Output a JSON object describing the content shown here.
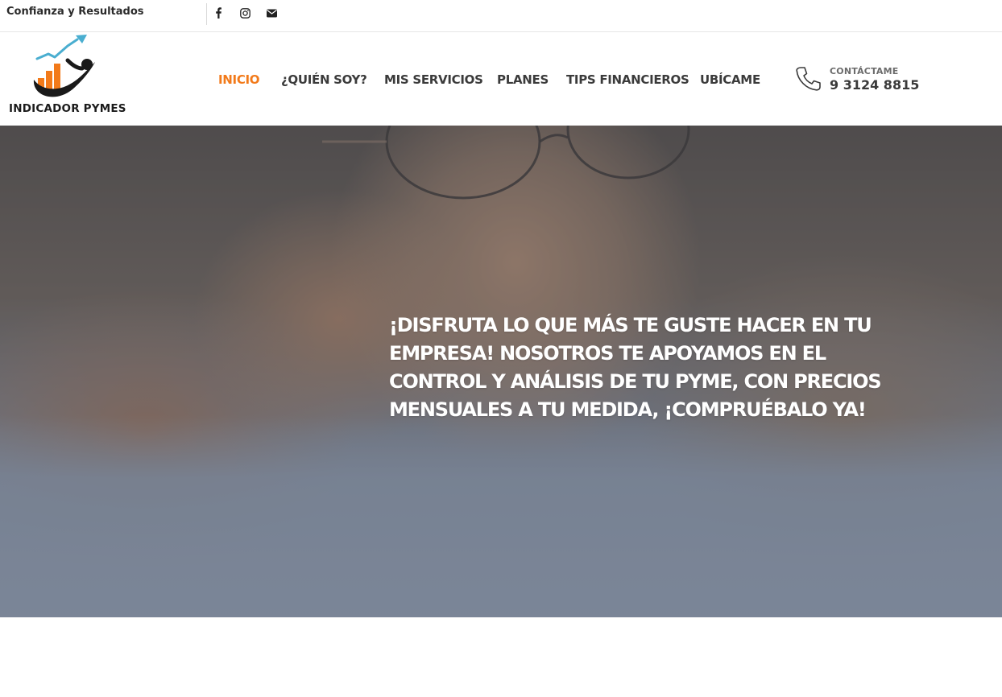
{
  "topbar": {
    "tagline": "Confianza y Resultados",
    "social": [
      {
        "icon": "facebook-icon"
      },
      {
        "icon": "instagram-icon"
      },
      {
        "icon": "envelope-icon"
      }
    ]
  },
  "header": {
    "logo_text": "INDICADOR PYMES",
    "nav": [
      {
        "label": "INICIO",
        "active": true
      },
      {
        "label": "¿QUIÉN SOY?",
        "active": false
      },
      {
        "label": "MIS SERVICIOS",
        "active": false
      },
      {
        "label": "PLANES",
        "active": false
      },
      {
        "label": "TIPS FINANCIEROS",
        "active": false
      },
      {
        "label": "UBÍCAME",
        "active": false
      }
    ],
    "contact": {
      "label": "CONTÁCTAME",
      "number": "9 3124 8815",
      "icon": "phone-icon"
    }
  },
  "hero": {
    "headline": "¡DISFRUTA LO QUE MÁS TE GUSTE HACER EN TU EMPRESA! NOSOTROS TE APOYAMOS EN EL CONTROL Y ANÁLISIS DE TU PYME, CON PRECIOS MENSUALES A TU MEDIDA, ¡COMPRUÉBALO YA!"
  },
  "colors": {
    "accent": "#f27a1a",
    "nav_text": "#3b3b3b",
    "hero_text": "#ffffff"
  }
}
